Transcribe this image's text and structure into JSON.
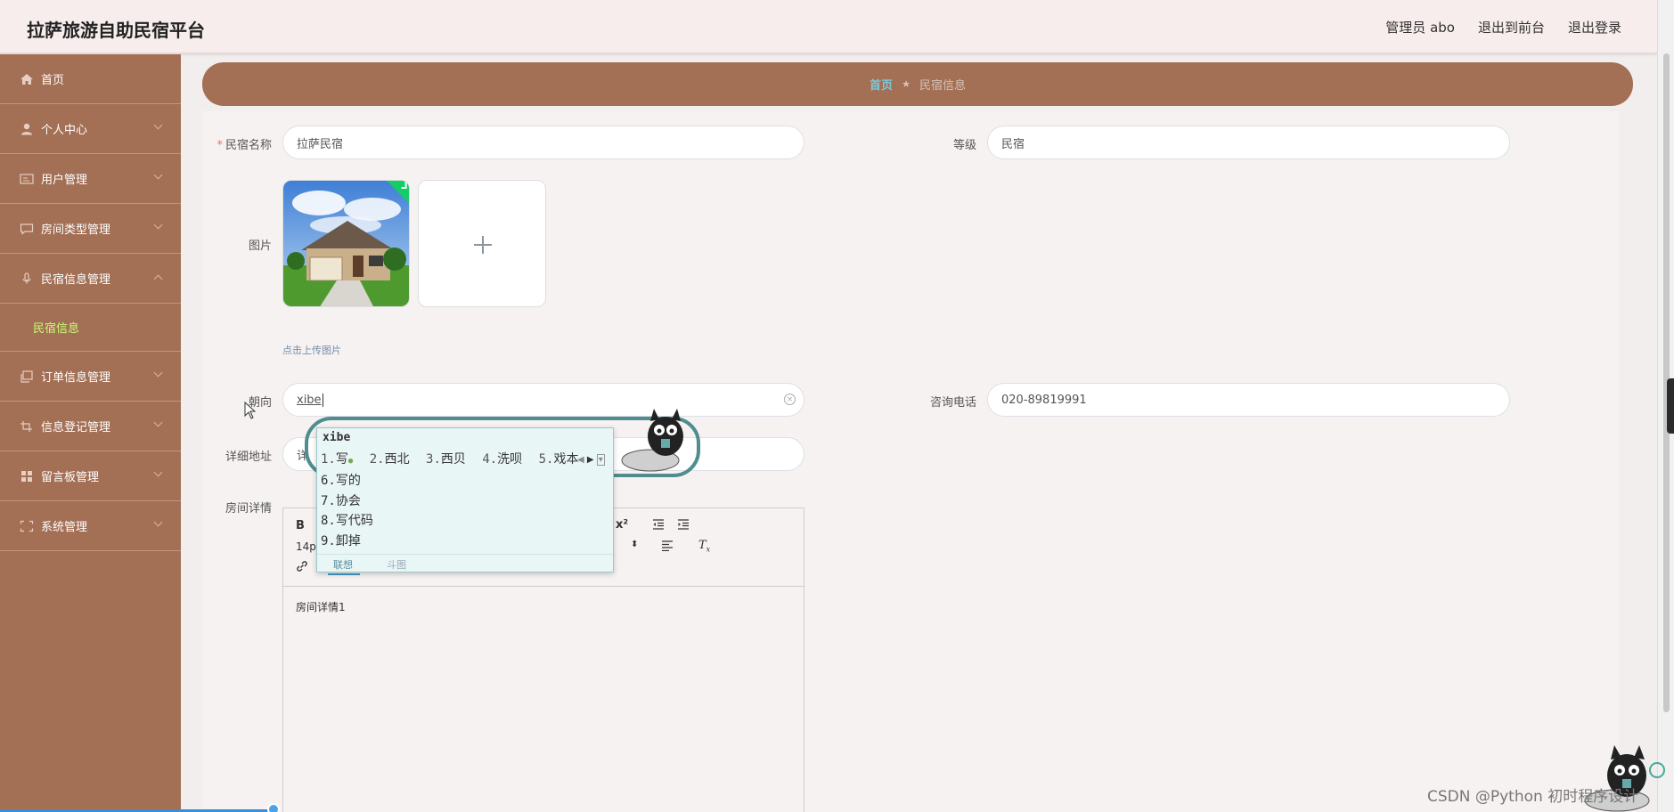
{
  "app": {
    "title": "拉萨旅游自助民宿平台"
  },
  "topnav": {
    "user": "管理员 abo",
    "to_front": "退出到前台",
    "logout": "退出登录"
  },
  "sidebar": {
    "items": [
      {
        "label": "首页",
        "icon": "home-icon"
      },
      {
        "label": "个人中心",
        "icon": "user-icon"
      },
      {
        "label": "用户管理",
        "icon": "id-card-icon"
      },
      {
        "label": "房间类型管理",
        "icon": "chat-icon"
      },
      {
        "label": "民宿信息管理",
        "icon": "mic-icon"
      },
      {
        "label": "订单信息管理",
        "icon": "copy-icon"
      },
      {
        "label": "信息登记管理",
        "icon": "crop-icon"
      },
      {
        "label": "留言板管理",
        "icon": "grid-icon"
      },
      {
        "label": "系统管理",
        "icon": "fullscreen-icon"
      }
    ],
    "sub_active": "民宿信息"
  },
  "breadcrumb": {
    "home": "首页",
    "current": "民宿信息"
  },
  "form": {
    "name_label": "民宿名称",
    "name_value": "拉萨民宿",
    "level_label": "等级",
    "level_value": "民宿",
    "image_label": "图片",
    "upload_hint": "点击上传图片",
    "orientation_label": "朝向",
    "orientation_value": "xibe",
    "phone_label": "咨询电话",
    "phone_value": "020-89819991",
    "address_label": "详细地址",
    "address_value": "详",
    "details_label": "房间详情",
    "details_body": "房间详情1",
    "editor_font_size": "14p"
  },
  "ime": {
    "pinyin": "xibe",
    "candidates": [
      {
        "num": "1.",
        "text": "写"
      },
      {
        "num": "2.",
        "text": "西北"
      },
      {
        "num": "3.",
        "text": "西贝"
      },
      {
        "num": "4.",
        "text": "洗呗"
      },
      {
        "num": "5.",
        "text": "戏本"
      }
    ],
    "more": [
      {
        "num": "6.",
        "text": "写的"
      },
      {
        "num": "7.",
        "text": "协会"
      },
      {
        "num": "8.",
        "text": "写代码"
      },
      {
        "num": "9.",
        "text": "卸掉"
      }
    ],
    "tab_assoc": "联想",
    "tab_meme": "斗图"
  },
  "watermark": "CSDN @Python 初时程序设计"
}
